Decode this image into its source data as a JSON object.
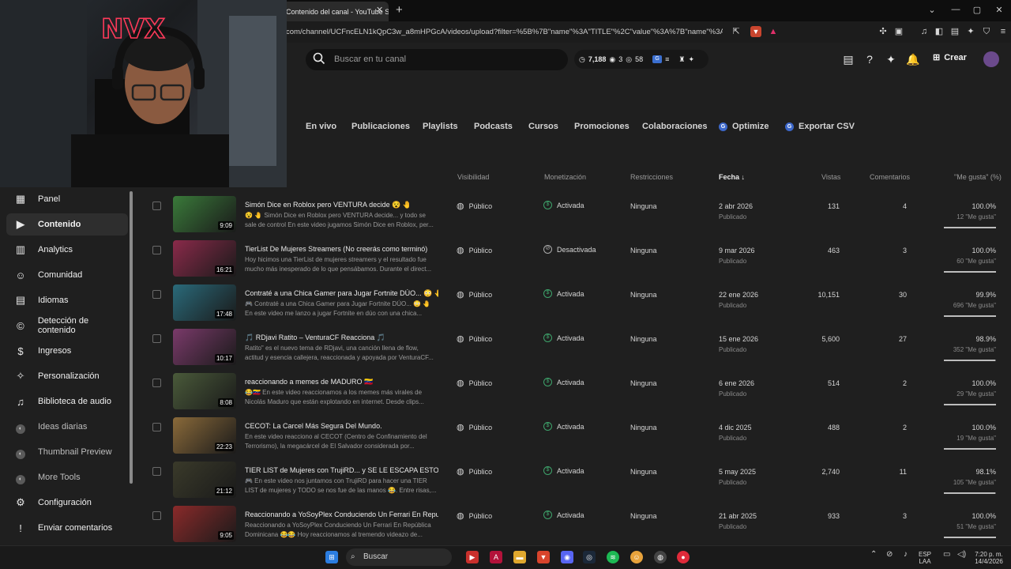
{
  "browser": {
    "tab_title": "Contenido del canal - YouTube S",
    "url": "com/channel/UCFncELN1kQpC3w_a8mHPGcA/videos/upload?filter=%5B%7B\"name\"%3A\"TITLE\"%2C\"value\"%3A%7B\"name\"%3A\"CO..."
  },
  "header": {
    "search_placeholder": "Buscar en tu canal",
    "stats": {
      "views": "7,188",
      "a": "3",
      "b": "58"
    },
    "crear": "Crear"
  },
  "content_tabs": [
    "En vivo",
    "Publicaciones",
    "Playlists",
    "Podcasts",
    "Cursos",
    "Promociones",
    "Colaboraciones",
    "Optimize",
    "Exportar CSV"
  ],
  "columns": {
    "visibilidad": "Visibilidad",
    "monetizacion": "Monetización",
    "restricciones": "Restricciones",
    "fecha": "Fecha",
    "vistas": "Vistas",
    "comentarios": "Comentarios",
    "megusta": "\"Me gusta\" (%)"
  },
  "sidebar": {
    "items": [
      {
        "label": "Panel",
        "icon": "dashboard-icon"
      },
      {
        "label": "Contenido",
        "icon": "content-icon",
        "active": true
      },
      {
        "label": "Analytics",
        "icon": "analytics-icon"
      },
      {
        "label": "Comunidad",
        "icon": "community-icon"
      },
      {
        "label": "Idiomas",
        "icon": "subtitles-icon"
      },
      {
        "label": "Detección de contenido",
        "icon": "copyright-icon"
      },
      {
        "label": "Ingresos",
        "icon": "money-icon"
      },
      {
        "label": "Personalización",
        "icon": "magic-wand-icon"
      },
      {
        "label": "Biblioteca de audio",
        "icon": "audio-library-icon"
      },
      {
        "label": "Ideas diarias",
        "icon": "extension-icon"
      },
      {
        "label": "Thumbnail Preview",
        "icon": "extension-icon"
      },
      {
        "label": "More Tools",
        "icon": "extension-icon"
      },
      {
        "label": "Configuración",
        "icon": "gear-icon"
      },
      {
        "label": "Enviar comentarios",
        "icon": "feedback-icon"
      }
    ]
  },
  "videos": [
    {
      "title": "Simón Dice en Roblox pero VENTURA decide 😵 🤚",
      "desc1": "😵 🤚 Simón Dice en Roblox pero VENTURA decide... y todo se",
      "desc2": "sale de control En este video jugamos Simón Dice en Roblox, per...",
      "duration": "9:09",
      "visibility": "Público",
      "monetization": "Activada",
      "restrictions": "Ninguna",
      "date": "2 abr 2026",
      "status": "Publicado",
      "views": "131",
      "comments": "4",
      "like_pct": "100.0%",
      "like_count": "12 \"Me gusta\"",
      "like_frac": 1.0,
      "thumb": "#3a7a3a"
    },
    {
      "title": "TierList De Mujeres Streamers (No creerás como terminó)",
      "desc1": "Hoy hicimos una TierList de mujeres streamers y el resultado fue",
      "desc2": "mucho más inesperado de lo que pensábamos. Durante el direct...",
      "duration": "16:21",
      "visibility": "Público",
      "monetization": "Desactivada",
      "restrictions": "Ninguna",
      "date": "9 mar 2026",
      "status": "Publicado",
      "views": "463",
      "comments": "3",
      "like_pct": "100.0%",
      "like_count": "60 \"Me gusta\"",
      "like_frac": 1.0,
      "thumb": "#8a2a4a"
    },
    {
      "title": "Contraté a una Chica Gamer para Jugar Fortnite DÚO... 😳 🤚",
      "desc1": "🎮 Contraté a una Chica Gamer para Jugar Fortnite DÚO... 😳 🤚",
      "desc2": "En este video me lanzo a jugar Fortnite en dúo con una chica...",
      "duration": "17:48",
      "visibility": "Público",
      "monetization": "Activada",
      "restrictions": "Ninguna",
      "date": "22 ene 2026",
      "status": "Publicado",
      "views": "10,151",
      "comments": "30",
      "like_pct": "99.9%",
      "like_count": "696 \"Me gusta\"",
      "like_frac": 0.999,
      "thumb": "#2a6a7a"
    },
    {
      "title": "🎵 RDjavi Ratito – VenturaCF Reacciona 🎵",
      "desc1": "Ratito\" es el nuevo tema de RDjavi, una canción llena de flow,",
      "desc2": "actitud y esencia callejera, reaccionada y apoyada por VenturaCF...",
      "duration": "10:17",
      "visibility": "Público",
      "monetization": "Activada",
      "restrictions": "Ninguna",
      "date": "15 ene 2026",
      "status": "Publicado",
      "views": "5,600",
      "comments": "27",
      "like_pct": "98.9%",
      "like_count": "352 \"Me gusta\"",
      "like_frac": 0.989,
      "thumb": "#7a3a6a"
    },
    {
      "title": "reaccionando a memes de MADURO 🇻🇪",
      "desc1": "😂🇻🇪 En este video reaccionamos a los memes más virales de",
      "desc2": "Nicolás Maduro que están explotando en internet. Desde clips...",
      "duration": "8:08",
      "visibility": "Público",
      "monetization": "Activada",
      "restrictions": "Ninguna",
      "date": "6 ene 2026",
      "status": "Publicado",
      "views": "514",
      "comments": "2",
      "like_pct": "100.0%",
      "like_count": "29 \"Me gusta\"",
      "like_frac": 1.0,
      "thumb": "#4a5a3a"
    },
    {
      "title": "CECOT: La Carcel Más Segura Del Mundo.",
      "desc1": "En este video reacciono al CECOT (Centro de Confinamiento del",
      "desc2": "Terrorismo), la megacárcel de El Salvador considerada por...",
      "duration": "22:23",
      "visibility": "Público",
      "monetization": "Activada",
      "restrictions": "Ninguna",
      "date": "4 dic 2025",
      "status": "Publicado",
      "views": "488",
      "comments": "2",
      "like_pct": "100.0%",
      "like_count": "19 \"Me gusta\"",
      "like_frac": 1.0,
      "thumb": "#8a6a3a"
    },
    {
      "title": "TIER LIST de Mujeres con TrujiRD... y SE LE ESCAPA ESTO 😱",
      "desc1": "🎮 En este video nos juntamos con TrujiRD para hacer una TIER",
      "desc2": "LIST de mujeres y TODO se nos fue de las manos 😂. Entre risas,...",
      "duration": "21:12",
      "visibility": "Público",
      "monetization": "Activada",
      "restrictions": "Ninguna",
      "date": "5 may 2025",
      "status": "Publicado",
      "views": "2,740",
      "comments": "11",
      "like_pct": "98.1%",
      "like_count": "105 \"Me gusta\"",
      "like_frac": 0.981,
      "thumb": "#3a3a2a"
    },
    {
      "title": "Reaccionando a YoSoyPlex Conduciendo Un Ferrari En Repub...",
      "desc1": "Reaccionando a YoSoyPlex Conduciendo Un Ferrari En República",
      "desc2": "Dominicana 😂😂 Hoy reaccionamos al tremendo videazo de...",
      "duration": "9:05",
      "visibility": "Público",
      "monetization": "Activada",
      "restrictions": "Ninguna",
      "date": "21 abr 2025",
      "status": "Publicado",
      "views": "933",
      "comments": "3",
      "like_pct": "100.0%",
      "like_count": "51 \"Me gusta\"",
      "like_frac": 1.0,
      "thumb": "#8a2a2a"
    }
  ],
  "taskbar": {
    "search": "Buscar",
    "lang1": "ESP",
    "lang2": "LAA",
    "time": "7:20 p. m.",
    "date": "14/4/2026"
  },
  "colors": {
    "accent_blue": "#3c67c9",
    "monetized": "#3ea36b",
    "tab_active_bg": "#2e2e2e"
  }
}
